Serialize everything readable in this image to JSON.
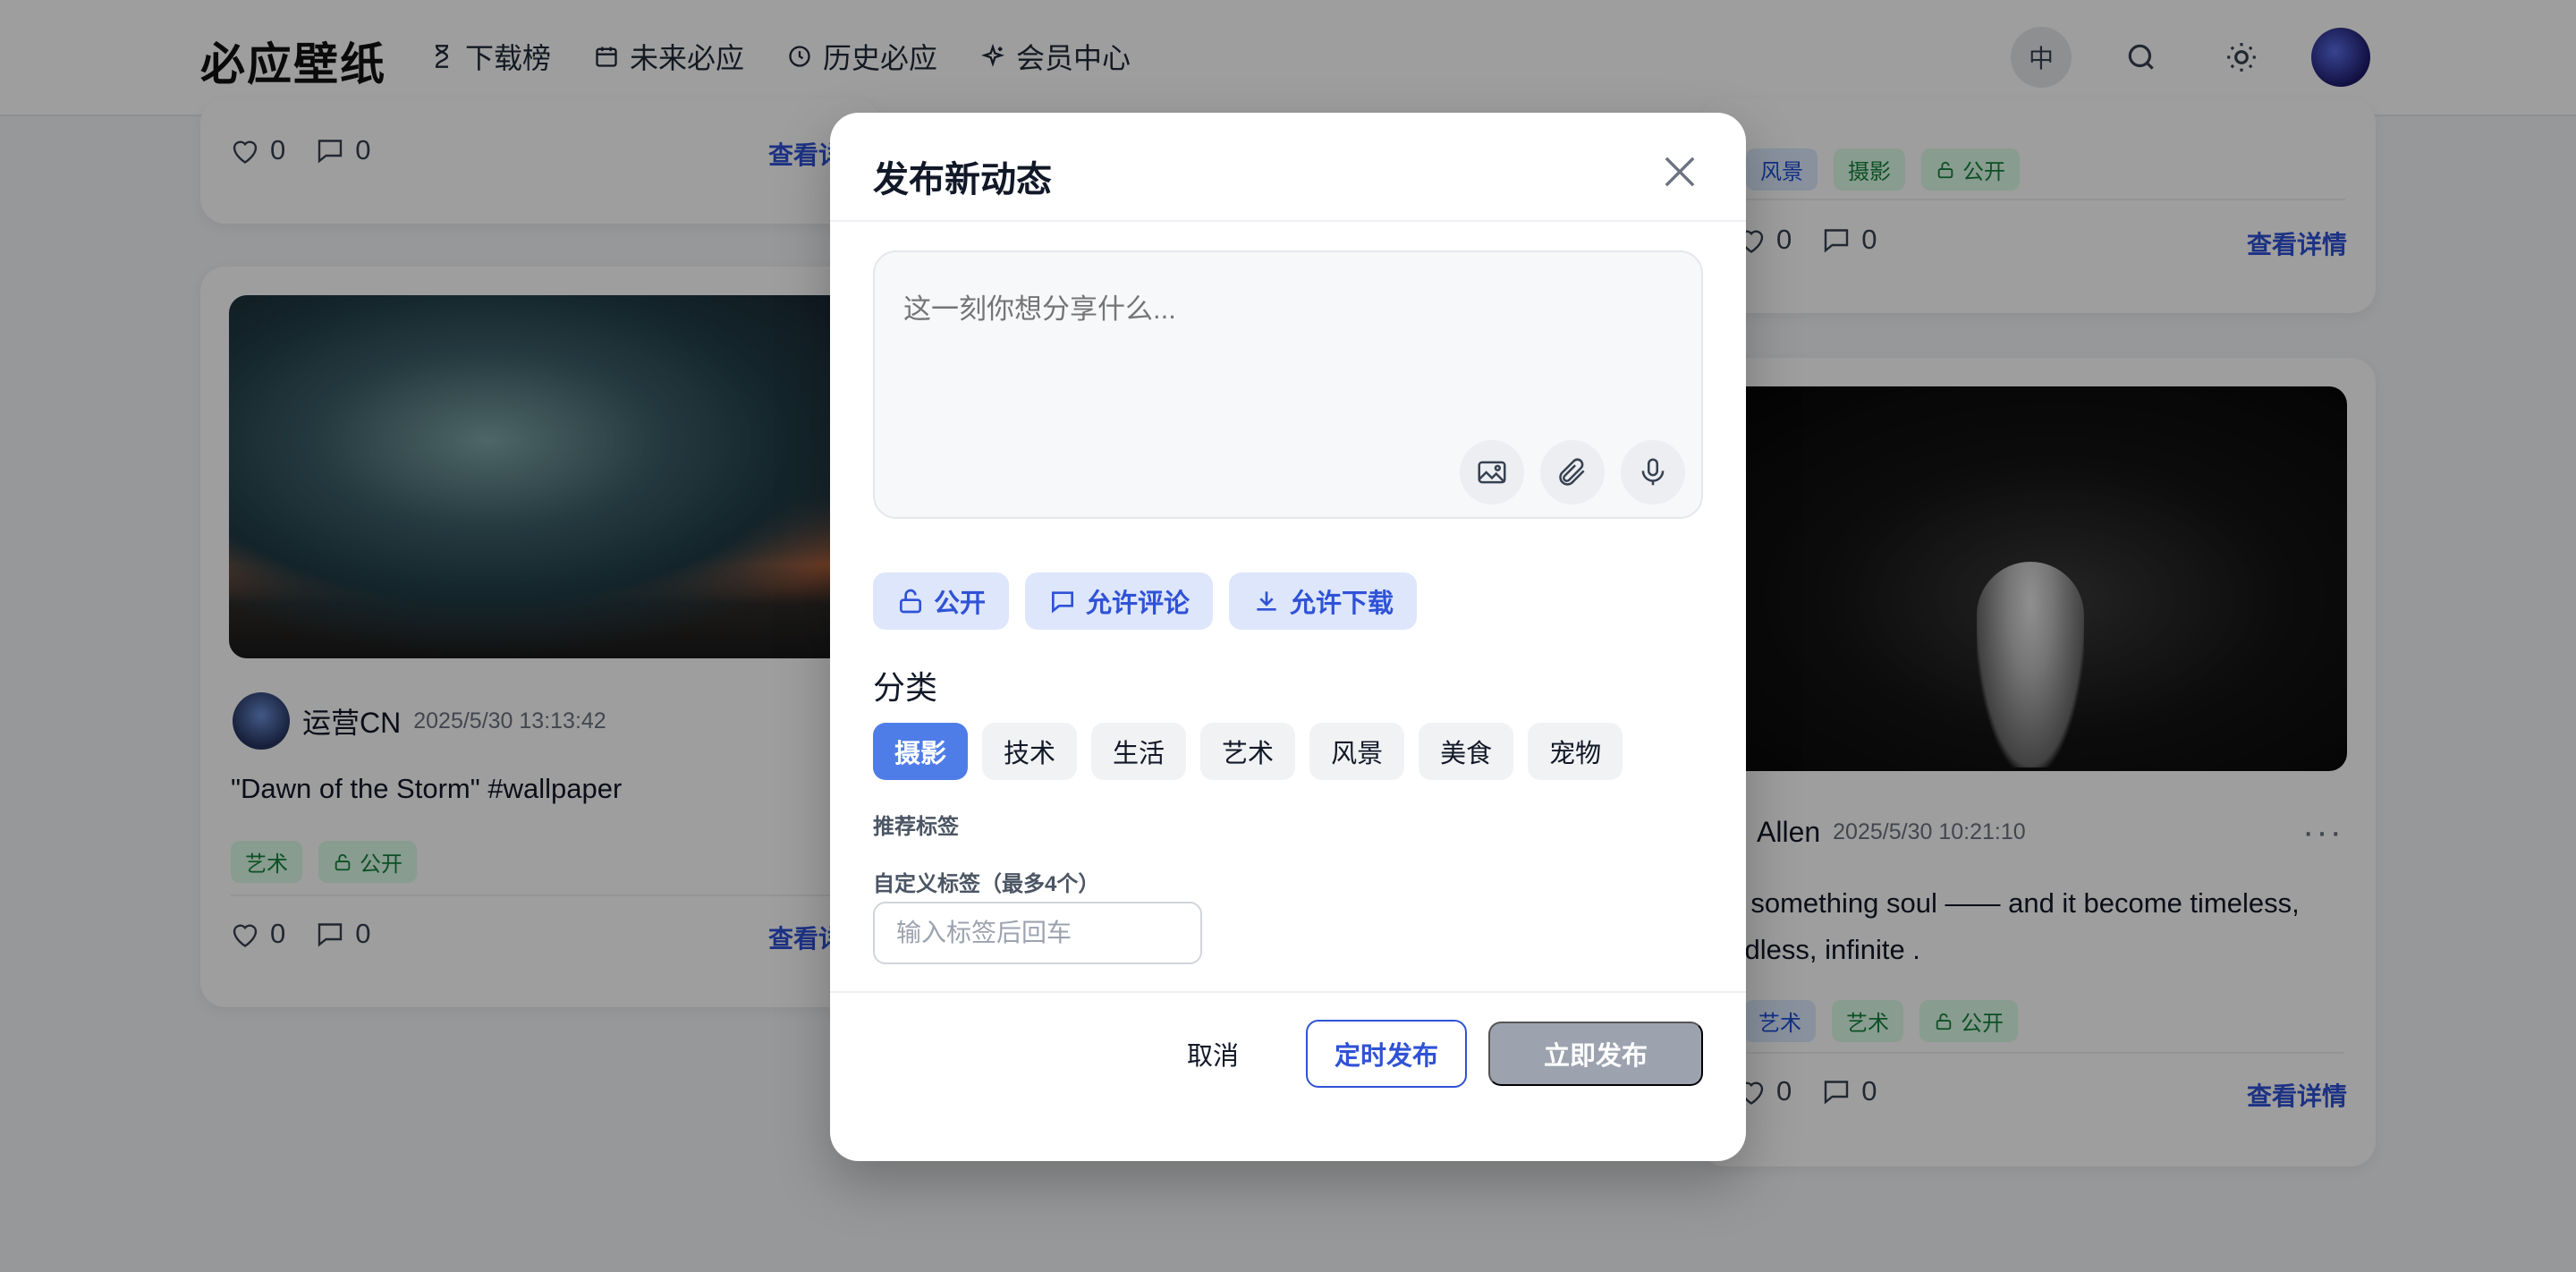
{
  "header": {
    "logo": "必应壁纸",
    "nav": [
      {
        "label": "下载榜",
        "icon": "hourglass-icon"
      },
      {
        "label": "未来必应",
        "icon": "calendar-icon"
      },
      {
        "label": "历史必应",
        "icon": "clock-icon"
      },
      {
        "label": "会员中心",
        "icon": "sparkle-icon"
      }
    ],
    "lang_label": "中"
  },
  "cards": {
    "top_left": {
      "likes": "0",
      "comments": "0",
      "detail": "查看详"
    },
    "mid_left": {
      "author": "运营CN",
      "date": "2025/5/30 13:13:42",
      "text": "\"Dawn of the Storm\" #wallpaper",
      "tags": [
        "艺术",
        "公开"
      ],
      "likes": "0",
      "comments": "0",
      "detail": "查看详"
    },
    "top_right": {
      "tags": [
        "风景",
        "摄影",
        "公开"
      ],
      "likes": "0",
      "comments": "0",
      "detail": "查看详情"
    },
    "mid_right": {
      "author": "Allen",
      "date": "2025/5/30 10:21:10",
      "text_line1": "ve something soul —— and it become timeless,",
      "text_line2": "undless, infinite .",
      "tags": [
        "艺术",
        "艺术",
        "公开"
      ],
      "likes": "0",
      "comments": "0",
      "detail": "查看详情"
    }
  },
  "modal": {
    "title": "发布新动态",
    "composer_placeholder": "这一刻你想分享什么...",
    "options": [
      {
        "label": "公开",
        "icon": "unlock-icon"
      },
      {
        "label": "允许评论",
        "icon": "comment-icon"
      },
      {
        "label": "允许下载",
        "icon": "download-icon"
      }
    ],
    "category_label": "分类",
    "categories": [
      "摄影",
      "技术",
      "生活",
      "艺术",
      "风景",
      "美食",
      "宠物"
    ],
    "selected_category": "摄影",
    "recommended_tags_label": "推荐标签",
    "custom_tags_label": "自定义标签（最多4个）",
    "custom_tags_placeholder": "输入标签后回车",
    "cancel": "取消",
    "schedule": "定时发布",
    "publish": "立即发布"
  },
  "colors": {
    "accent": "#2f52d6",
    "active_category": "#4f7de8",
    "disabled_button": "#9ca3af"
  }
}
